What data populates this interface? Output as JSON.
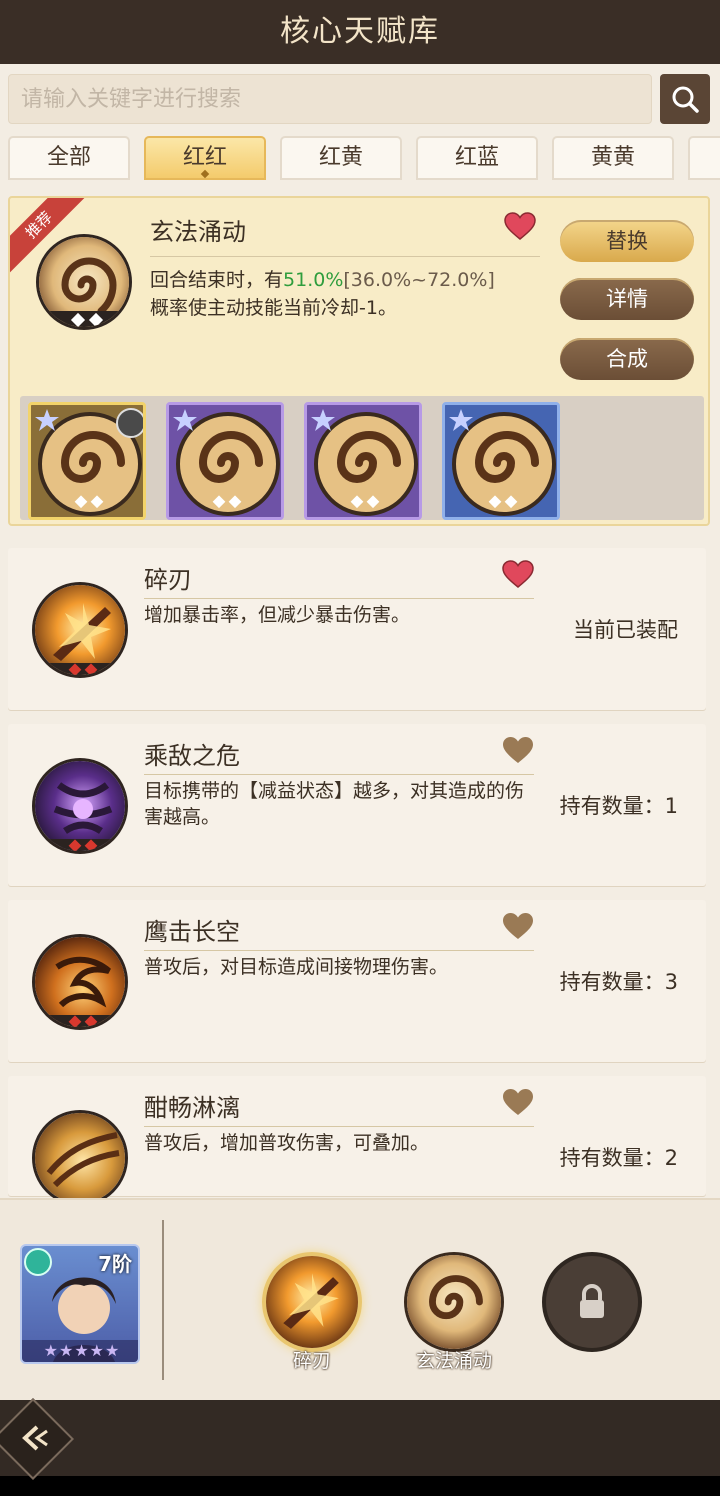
{
  "header": {
    "title": "核心天赋库"
  },
  "search": {
    "placeholder": "请输入关键字进行搜索"
  },
  "tabs": [
    {
      "label": "全部",
      "active": false
    },
    {
      "label": "红红",
      "active": true
    },
    {
      "label": "红黄",
      "active": false
    },
    {
      "label": "红蓝",
      "active": false
    },
    {
      "label": "黄黄",
      "active": false
    }
  ],
  "featured": {
    "ribbon": "推荐",
    "name": "玄法涌动",
    "desc_prefix": "回合结束时，有",
    "chance": "51.0%",
    "range": "[36.0%~72.0%]",
    "desc_suffix": "概率使主动技能当前冷却-1。",
    "buttons": {
      "replace": "替换",
      "details": "详情",
      "synthesize": "合成"
    },
    "favorite": true
  },
  "talents": [
    {
      "name": "碎刃",
      "desc": "增加暴击率，但减少暴击伤害。",
      "status": "当前已装配",
      "favorite": true
    },
    {
      "name": "乘敌之危",
      "desc": "目标携带的【减益状态】越多，对其造成的伤害越高。",
      "status": "持有数量：1",
      "favorite": false
    },
    {
      "name": "鹰击长空",
      "desc": "普攻后，对目标造成间接物理伤害。",
      "status": "持有数量：3",
      "favorite": false
    },
    {
      "name": "酣畅淋漓",
      "desc": "普攻后，增加普攻伤害，可叠加。",
      "status": "持有数量：2",
      "favorite": false
    }
  ],
  "character": {
    "rank": "7阶",
    "stars": "★★★★★"
  },
  "equipped": [
    {
      "label": "碎刃"
    },
    {
      "label": "玄法涌动"
    }
  ],
  "colors": {
    "accent": "#f4cb6c",
    "green": "#2f9d3d",
    "heart_red": "#e0485c",
    "heart_brown": "#9a7a55"
  }
}
